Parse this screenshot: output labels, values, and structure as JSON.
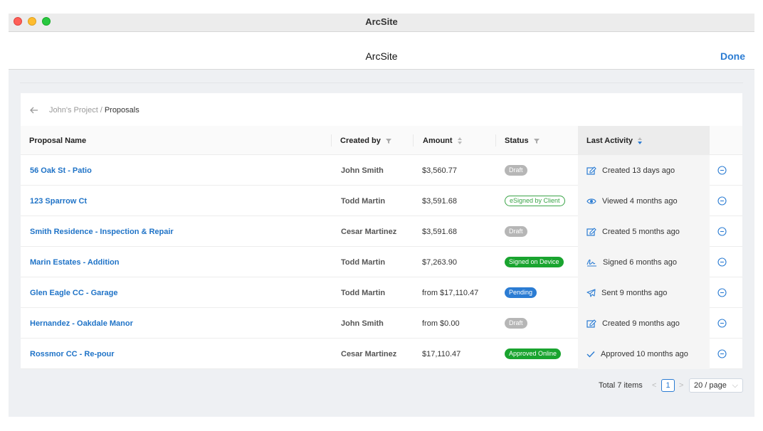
{
  "window": {
    "title": "ArcSite"
  },
  "navbar": {
    "title": "ArcSite",
    "done_label": "Done"
  },
  "breadcrumb": {
    "parent": "John's Project",
    "separator": "/",
    "current": "Proposals"
  },
  "columns": {
    "name": "Proposal Name",
    "created_by": "Created by",
    "amount": "Amount",
    "status": "Status",
    "last_activity": "Last Activity"
  },
  "rows": [
    {
      "name": "56 Oak St - Patio",
      "created_by": "John Smith",
      "amount": "$3,560.77",
      "status": "Draft",
      "status_type": "draft",
      "activity_icon": "edit-icon",
      "activity": "Created 13 days ago"
    },
    {
      "name": "123 Sparrow Ct",
      "created_by": "Todd Martin",
      "amount": "$3,591.68",
      "status": "eSigned by Client",
      "status_type": "esigned",
      "activity_icon": "eye-icon",
      "activity": "Viewed 4 months ago"
    },
    {
      "name": "Smith Residence - Inspection & Repair",
      "created_by": "Cesar Martinez",
      "amount": "$3,591.68",
      "status": "Draft",
      "status_type": "draft",
      "activity_icon": "edit-icon",
      "activity": "Created 5 months ago"
    },
    {
      "name": "Marin Estates - Addition",
      "created_by": "Todd Martin",
      "amount": "$7,263.90",
      "status": "Signed on Device",
      "status_type": "signed",
      "activity_icon": "signature-icon",
      "activity": "Signed 6 months ago"
    },
    {
      "name": "Glen Eagle CC - Garage",
      "created_by": "Todd Martin",
      "amount": "from $17,110.47",
      "status": "Pending",
      "status_type": "pending",
      "activity_icon": "send-icon",
      "activity": "Sent 9 months ago"
    },
    {
      "name": "Hernandez - Oakdale Manor",
      "created_by": "John Smith",
      "amount": "from $0.00",
      "status": "Draft",
      "status_type": "draft",
      "activity_icon": "edit-icon",
      "activity": "Created 9 months ago"
    },
    {
      "name": "Rossmor CC - Re-pour",
      "created_by": "Cesar Martinez",
      "amount": "$17,110.47",
      "status": "Approved Online",
      "status_type": "approved",
      "activity_icon": "check-icon",
      "activity": "Approved 10 months ago"
    }
  ],
  "pagination": {
    "total": "Total 7 items",
    "prev": "<",
    "page": "1",
    "next": ">",
    "page_size": "20 / page"
  },
  "colors": {
    "accent": "#2b7cd3",
    "link": "#1f73c7",
    "draft": "#b6b6b6",
    "success": "#19a42f",
    "esigned": "#3aa447"
  }
}
